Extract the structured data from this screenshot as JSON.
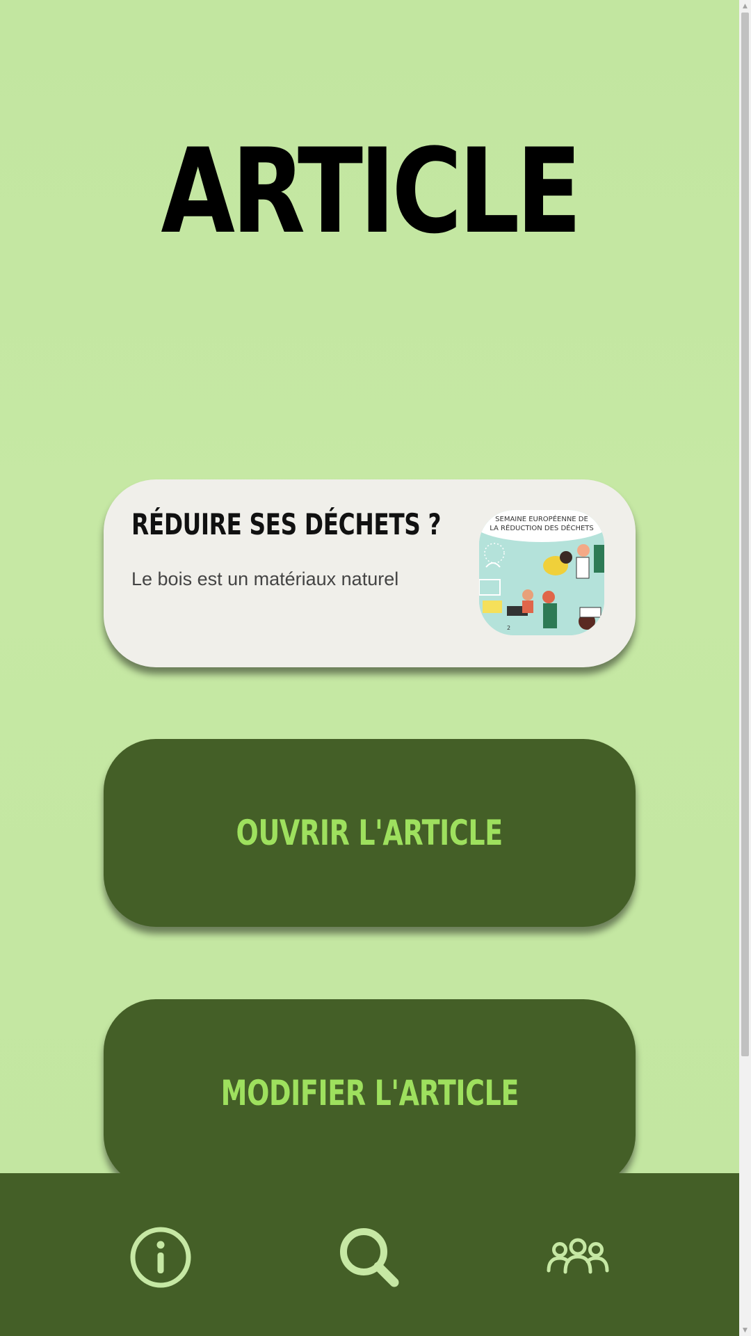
{
  "page": {
    "title": "ARTICLE"
  },
  "article_card": {
    "title": "RÉDUIRE SES DÉCHETS ?",
    "description": "Le bois est un matériaux naturel",
    "image": {
      "icon": "article-thumbnail-illustration",
      "banner_line1": "SEMAINE EUROPÉENNE DE",
      "banner_line2": "LA RÉDUCTION DES DÉCHETS"
    }
  },
  "buttons": {
    "open_label": "OUVRIR L'ARTICLE",
    "edit_label": "MODIFIER L'ARTICLE"
  },
  "bottom_nav": {
    "items": [
      {
        "icon": "info-icon"
      },
      {
        "icon": "search-icon"
      },
      {
        "icon": "users-icon"
      }
    ]
  },
  "colors": {
    "background": "#c2e6a0",
    "dark_green": "#445f27",
    "accent_green": "#9ee05e",
    "card_bg": "#f0efea",
    "icon_light": "#c6e8a4"
  }
}
